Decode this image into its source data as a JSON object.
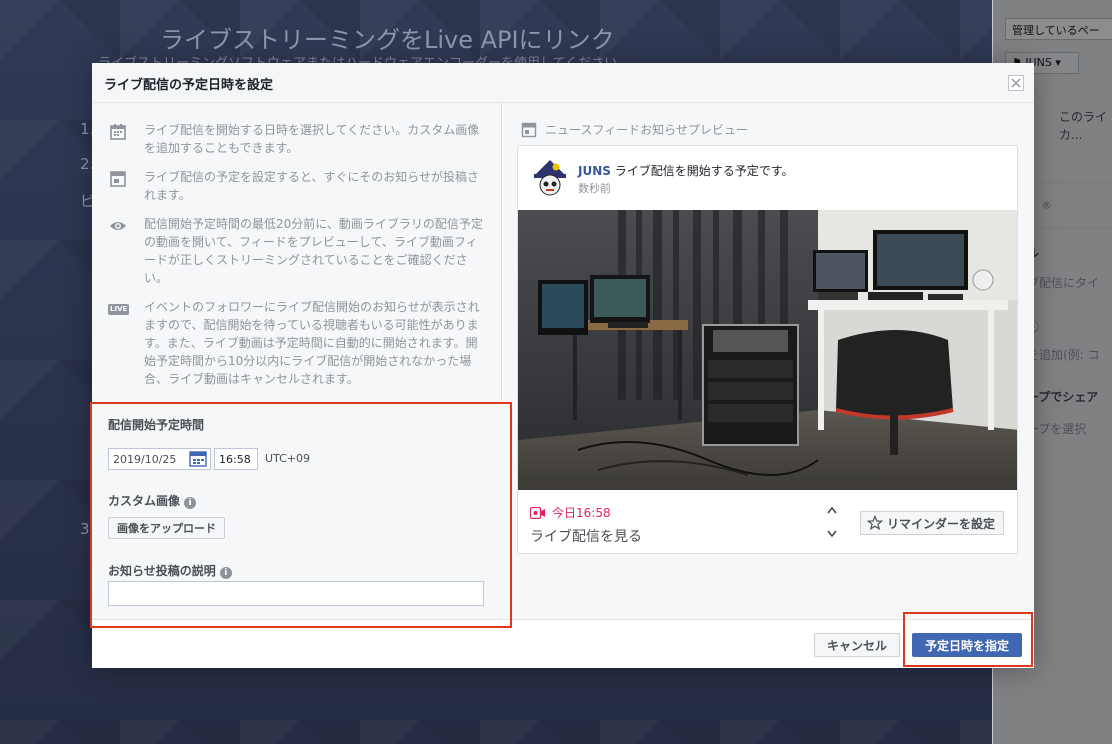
{
  "background": {
    "title": "ライブストリーミングをLive APIにリンク",
    "subtitle": "ライブストリーミングソフトウェアまたはハードウェアエンコーダーを使用してください",
    "steps": [
      "1.",
      "2.",
      "ビ",
      "3."
    ]
  },
  "sidebar": {
    "page_select": "管理しているペー",
    "page_button": "JUNS",
    "title_preview": "このライ",
    "title_preview_2": "カ...",
    "section_title": "ル",
    "section_text": "ブ配信にタイ",
    "tag_text": "を追加(例: コ",
    "share_title": "ープでシェア",
    "share_text": "ープを選択"
  },
  "modal": {
    "title": "ライブ配信の予定日時を設定",
    "info": [
      {
        "icon": "calendar-icon",
        "text": "ライブ配信を開始する日時を選択してください。カスタム画像を追加することもできます。"
      },
      {
        "icon": "post-icon",
        "text": "ライブ配信の予定を設定すると、すぐにそのお知らせが投稿されます。"
      },
      {
        "icon": "eye-icon",
        "text": "配信開始予定時間の最低20分前に、動画ライブラリの配信予定の動画を開いて、フィードをプレビューして、ライブ動画フィードが正しくストリーミングされていることをご確認ください。"
      },
      {
        "icon": "live-icon",
        "badge": "LIVE",
        "text": "イベントのフォロワーにライブ配信開始のお知らせが表示されますので、配信開始を待っている視聴者もいる可能性があります。また、ライブ動画は予定時間に自動的に開始されます。開始予定時間から10分以内にライブ配信が開始されなかった場合、ライブ動画はキャンセルされます。"
      }
    ],
    "form": {
      "start_label": "配信開始予定時間",
      "date_value": "2019/10/25",
      "time_value": "16:58",
      "timezone": "UTC+09",
      "custom_image_label": "カスタム画像",
      "upload_label": "画像をアップロード",
      "description_label": "お知らせ投稿の説明",
      "description_value": ""
    },
    "preview": {
      "title": "ニュースフィードお知らせプレビュー",
      "author": "JUNS",
      "headline": "ライブ配信を開始する予定です。",
      "time": "数秒前",
      "event_time": "今日16:58",
      "event_title": "ライブ配信を見る",
      "reminder_label": "リマインダーを設定"
    },
    "footer": {
      "cancel_label": "キャンセル",
      "confirm_label": "予定日時を指定"
    }
  },
  "colors": {
    "accent": "#4267b2",
    "highlight": "#e0381c",
    "event_red": "#e0245e",
    "link": "#365899"
  }
}
